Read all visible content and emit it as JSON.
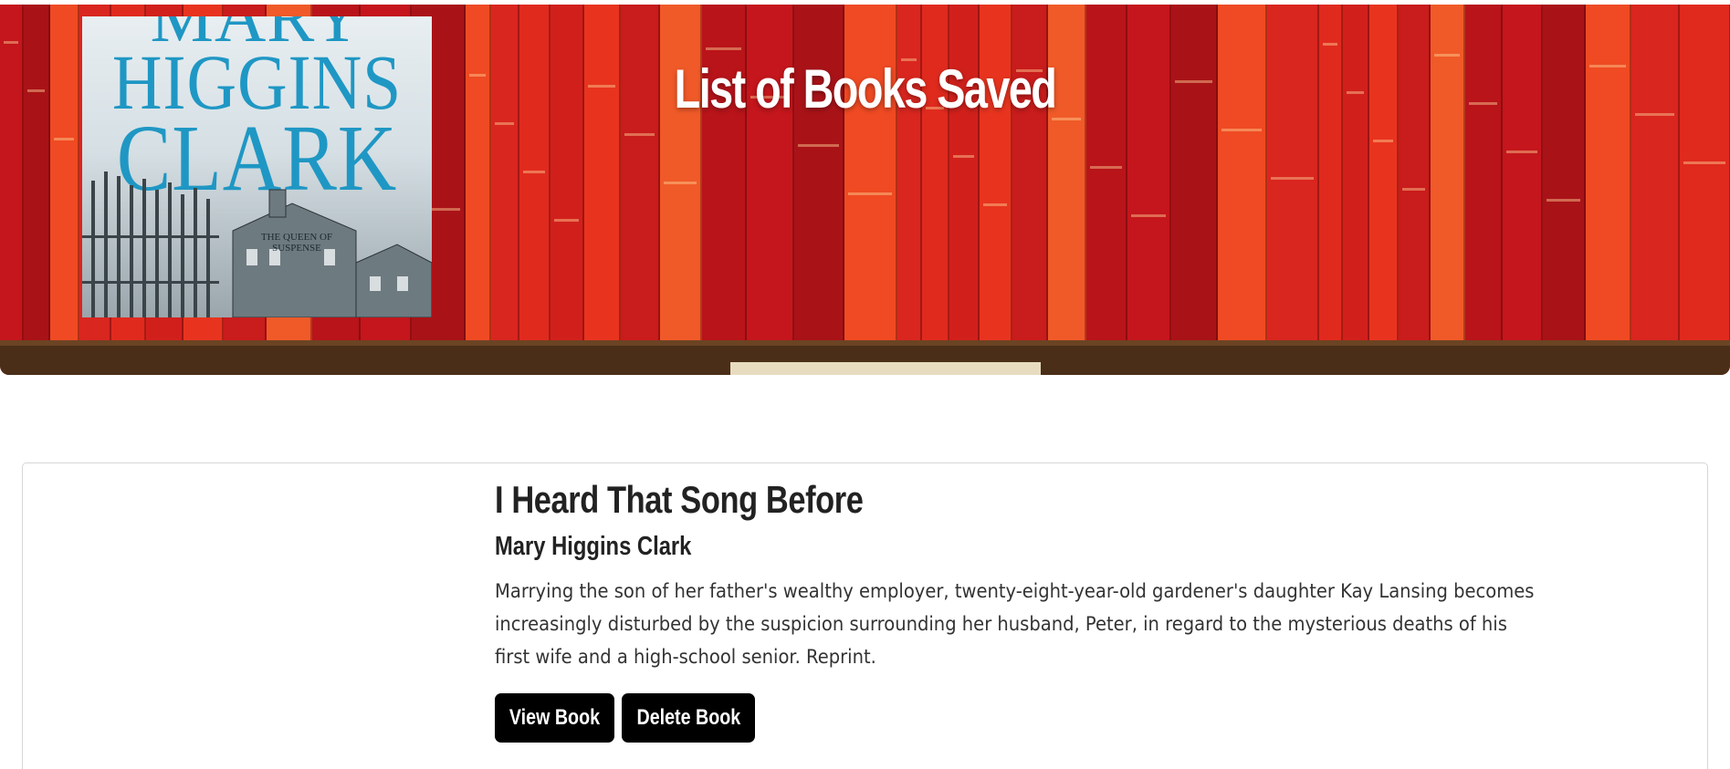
{
  "hero": {
    "title": "List of Books Saved"
  },
  "book": {
    "title": "I Heard That Song Before",
    "author": "Mary Higgins Clark",
    "description": "Marrying the son of her father's wealthy employer, twenty-eight-year-old gardener's daughter Kay Lansing becomes increasingly disturbed by the suspicion surrounding her husband, Peter, in regard to the mysterious deaths of his first wife and a high-school senior. Reprint.",
    "cover": {
      "author_line1": "MARY",
      "author_line2": "HIGGINS",
      "author_line3": "CLARK",
      "tagline": "The Queen of Suspense"
    }
  },
  "buttons": {
    "view_label": "View Book",
    "delete_label": "Delete Book"
  },
  "colors": {
    "hero_red": "#c2191a",
    "button_bg": "#000000",
    "button_text": "#ffffff",
    "cover_blue": "#1f97c4"
  }
}
